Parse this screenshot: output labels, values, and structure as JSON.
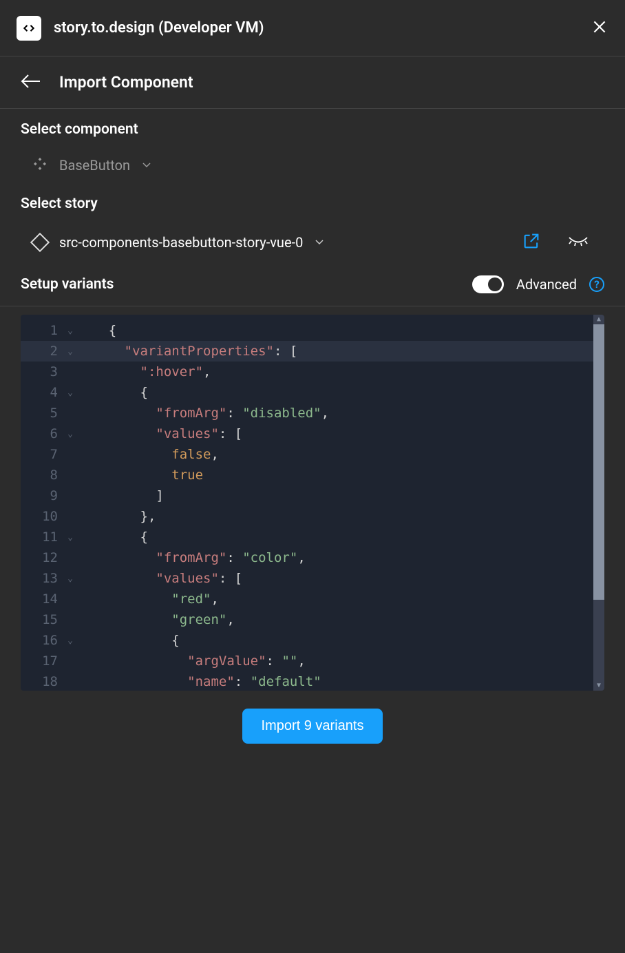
{
  "header": {
    "app_title": "story.to.design (Developer VM)"
  },
  "nav": {
    "title": "Import Component"
  },
  "select_component": {
    "heading": "Select component",
    "value": "BaseButton"
  },
  "select_story": {
    "heading": "Select story",
    "value": "src-components-basebutton-story-vue-0"
  },
  "setup_variants": {
    "heading": "Setup variants",
    "advanced_label": "Advanced",
    "advanced_on": true
  },
  "editor": {
    "lines": [
      {
        "n": 1,
        "fold": true,
        "tokens": [
          [
            "    ",
            "p"
          ],
          [
            "{",
            "p"
          ]
        ]
      },
      {
        "n": 2,
        "fold": true,
        "current": true,
        "tokens": [
          [
            "      ",
            "p"
          ],
          [
            "\"variantProperties\"",
            "k"
          ],
          [
            ": [",
            "p"
          ]
        ]
      },
      {
        "n": 3,
        "fold": false,
        "tokens": [
          [
            "        ",
            "p"
          ],
          [
            "\":hover\"",
            "k"
          ],
          [
            ",",
            "p"
          ]
        ]
      },
      {
        "n": 4,
        "fold": true,
        "tokens": [
          [
            "        ",
            "p"
          ],
          [
            "{",
            "p"
          ]
        ]
      },
      {
        "n": 5,
        "fold": false,
        "tokens": [
          [
            "          ",
            "p"
          ],
          [
            "\"fromArg\"",
            "k"
          ],
          [
            ": ",
            "p"
          ],
          [
            "\"disabled\"",
            "s"
          ],
          [
            ",",
            "p"
          ]
        ]
      },
      {
        "n": 6,
        "fold": true,
        "tokens": [
          [
            "          ",
            "p"
          ],
          [
            "\"values\"",
            "k"
          ],
          [
            ": [",
            "p"
          ]
        ]
      },
      {
        "n": 7,
        "fold": false,
        "tokens": [
          [
            "            ",
            "p"
          ],
          [
            "false",
            "b"
          ],
          [
            ",",
            "p"
          ]
        ]
      },
      {
        "n": 8,
        "fold": false,
        "tokens": [
          [
            "            ",
            "p"
          ],
          [
            "true",
            "b"
          ]
        ]
      },
      {
        "n": 9,
        "fold": false,
        "tokens": [
          [
            "          ",
            "p"
          ],
          [
            "]",
            "p"
          ]
        ]
      },
      {
        "n": 10,
        "fold": false,
        "tokens": [
          [
            "        ",
            "p"
          ],
          [
            "},",
            "p"
          ]
        ]
      },
      {
        "n": 11,
        "fold": true,
        "tokens": [
          [
            "        ",
            "p"
          ],
          [
            "{",
            "p"
          ]
        ]
      },
      {
        "n": 12,
        "fold": false,
        "tokens": [
          [
            "          ",
            "p"
          ],
          [
            "\"fromArg\"",
            "k"
          ],
          [
            ": ",
            "p"
          ],
          [
            "\"color\"",
            "s"
          ],
          [
            ",",
            "p"
          ]
        ]
      },
      {
        "n": 13,
        "fold": true,
        "tokens": [
          [
            "          ",
            "p"
          ],
          [
            "\"values\"",
            "k"
          ],
          [
            ": [",
            "p"
          ]
        ]
      },
      {
        "n": 14,
        "fold": false,
        "tokens": [
          [
            "            ",
            "p"
          ],
          [
            "\"red\"",
            "s"
          ],
          [
            ",",
            "p"
          ]
        ]
      },
      {
        "n": 15,
        "fold": false,
        "tokens": [
          [
            "            ",
            "p"
          ],
          [
            "\"green\"",
            "s"
          ],
          [
            ",",
            "p"
          ]
        ]
      },
      {
        "n": 16,
        "fold": true,
        "tokens": [
          [
            "            ",
            "p"
          ],
          [
            "{",
            "p"
          ]
        ]
      },
      {
        "n": 17,
        "fold": false,
        "tokens": [
          [
            "              ",
            "p"
          ],
          [
            "\"argValue\"",
            "k"
          ],
          [
            ": ",
            "p"
          ],
          [
            "\"\"",
            "s"
          ],
          [
            ",",
            "p"
          ]
        ]
      },
      {
        "n": 18,
        "fold": false,
        "tokens": [
          [
            "              ",
            "p"
          ],
          [
            "\"name\"",
            "k"
          ],
          [
            ": ",
            "p"
          ],
          [
            "\"default\"",
            "s"
          ]
        ]
      }
    ]
  },
  "footer": {
    "import_label": "Import 9 variants"
  }
}
